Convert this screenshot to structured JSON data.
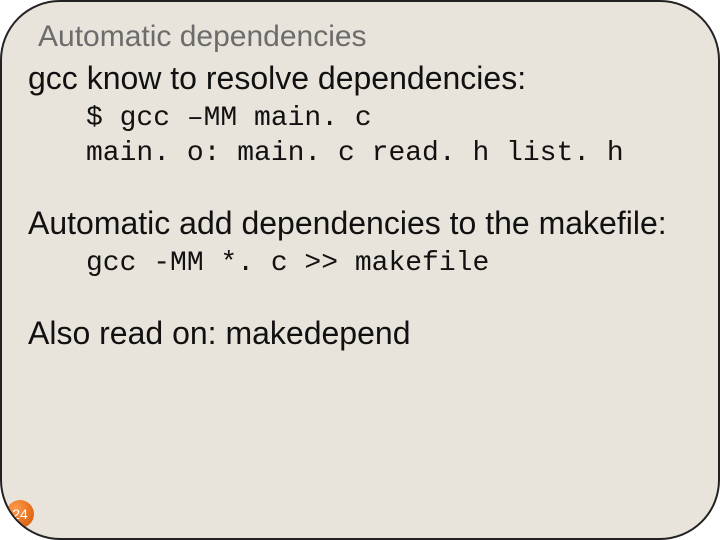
{
  "slide": {
    "title": "Automatic dependencies",
    "line1": "gcc know to resolve dependencies:",
    "code1": "$ gcc –MM main. c\nmain. o: main. c read. h list. h",
    "line2": "Automatic add dependencies to the makefile:",
    "code2": "gcc -MM *. c >> makefile",
    "line3": "Also read on: makedepend",
    "page_number": "24"
  }
}
